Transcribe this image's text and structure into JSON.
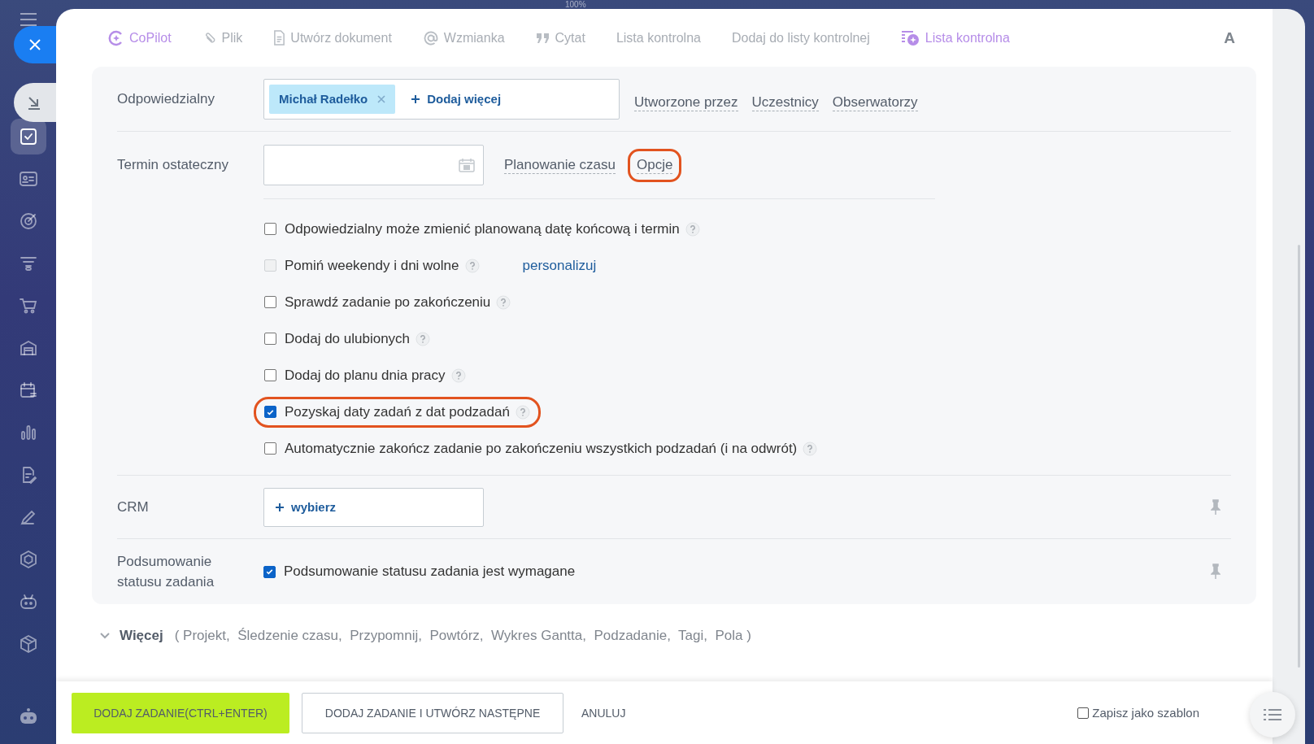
{
  "zoom_label": "100%",
  "sidebar": {
    "items": [
      {
        "kind": "checkbox",
        "selected": true
      },
      {
        "kind": "contact-card",
        "selected": false
      },
      {
        "kind": "target",
        "selected": false
      },
      {
        "kind": "funnel",
        "selected": false
      },
      {
        "kind": "cart",
        "selected": false
      },
      {
        "kind": "warehouse",
        "selected": false
      },
      {
        "kind": "calendar",
        "selected": false
      },
      {
        "kind": "bar-chart",
        "selected": false
      },
      {
        "kind": "document-pen",
        "selected": false
      },
      {
        "kind": "pen",
        "selected": false
      },
      {
        "kind": "hexagon",
        "selected": false
      },
      {
        "kind": "robot",
        "selected": false
      },
      {
        "kind": "box",
        "selected": false
      }
    ]
  },
  "toolbar": {
    "items": [
      {
        "kind": "copilot",
        "label": "CoPilot"
      },
      {
        "kind": "file",
        "label": "Plik"
      },
      {
        "kind": "document",
        "label": "Utwórz dokument"
      },
      {
        "kind": "mention",
        "label": "Wzmianka"
      },
      {
        "kind": "quote",
        "label": "Cytat"
      },
      {
        "kind": "plain",
        "label": "Lista kontrolna"
      },
      {
        "kind": "plain",
        "label": "Dodaj do listy kontrolnej"
      },
      {
        "kind": "ai-checklist",
        "label": "Lista kontrolna"
      }
    ],
    "format_button": "A"
  },
  "responsible": {
    "label": "Odpowiedzialny",
    "person": "Michał Radełko",
    "add_more": "Dodaj więcej",
    "links": [
      "Utworzone przez",
      "Uczestnicy",
      "Obserwatorzy"
    ]
  },
  "deadline": {
    "label": "Termin ostateczny",
    "links": [
      {
        "label": "Planowanie czasu",
        "highlighted": false
      },
      {
        "label": "Opcje",
        "highlighted": true
      }
    ]
  },
  "options": [
    {
      "label": "Odpowiedzialny może zmienić planowaną datę końcową i termin",
      "checked": false,
      "disabled": false,
      "highlighted": false
    },
    {
      "label": "Pomiń weekendy i dni wolne",
      "checked": false,
      "disabled": true,
      "highlighted": false,
      "link": "personalizuj"
    },
    {
      "label": "Sprawdź zadanie po zakończeniu",
      "checked": false,
      "disabled": false,
      "highlighted": false
    },
    {
      "label": "Dodaj do ulubionych",
      "checked": false,
      "disabled": false,
      "highlighted": false
    },
    {
      "label": "Dodaj do planu dnia pracy",
      "checked": false,
      "disabled": false,
      "highlighted": false
    },
    {
      "label": "Pozyskaj daty zadań z dat podzadań",
      "checked": true,
      "disabled": false,
      "highlighted": true
    },
    {
      "label": "Automatycznie zakończ zadanie po zakończeniu wszystkich podzadań (i na odwrót)",
      "checked": false,
      "disabled": false,
      "highlighted": false
    }
  ],
  "crm": {
    "label": "CRM",
    "button": "wybierz"
  },
  "status_summary": {
    "label": "Podsumowanie statusu zadania",
    "checkbox_label": "Podsumowanie statusu zadania jest wymagane",
    "checked": true
  },
  "more": {
    "label": "Więcej",
    "items": "( Projekt,  Śledzenie czasu,  Przypomnij,  Powtórz,  Wykres Gantta,  Podzadanie,  Tagi,  Pola )"
  },
  "footer": {
    "primary": "DODAJ ZADANIE(CTRL+ENTER)",
    "secondary": "DODAJ ZADANIE I UTWÓRZ NASTĘPNE",
    "cancel": "ANULUJ",
    "template": {
      "label": "Zapisz jako szablon",
      "checked": false
    }
  }
}
